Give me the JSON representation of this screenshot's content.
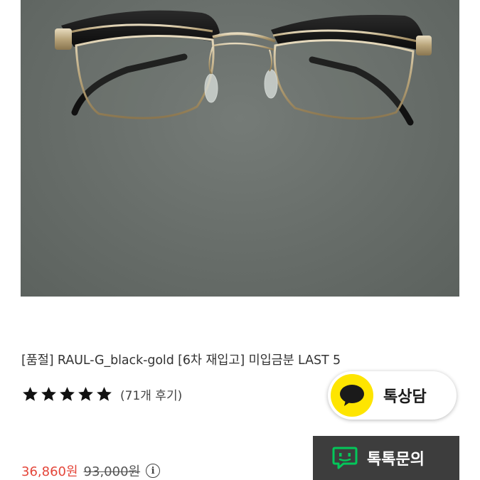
{
  "product": {
    "title": "[품절] RAUL-G_black-gold [6차 재입고] 미입금분 LAST 5",
    "image_alt": "RAUL-G black-gold glasses",
    "rating_stars": 5,
    "review_count_text": "(71개 후기)",
    "sale_price": "36,860원",
    "original_price": "93,000원"
  },
  "buttons": {
    "kakao_chat_label": "톡상담",
    "talktalk_label": "톡톡문의"
  },
  "colors": {
    "sale_price": "#e4463a",
    "kakao_yellow": "#fee500",
    "talktalk_bg": "#3d3d3d",
    "talktalk_green": "#03c75a",
    "image_background": "#686e6a"
  },
  "icons": {
    "star": "star-icon",
    "kakao": "kakao-speech-bubble-icon",
    "talktalk": "naver-talktalk-icon",
    "info": "info-icon"
  }
}
